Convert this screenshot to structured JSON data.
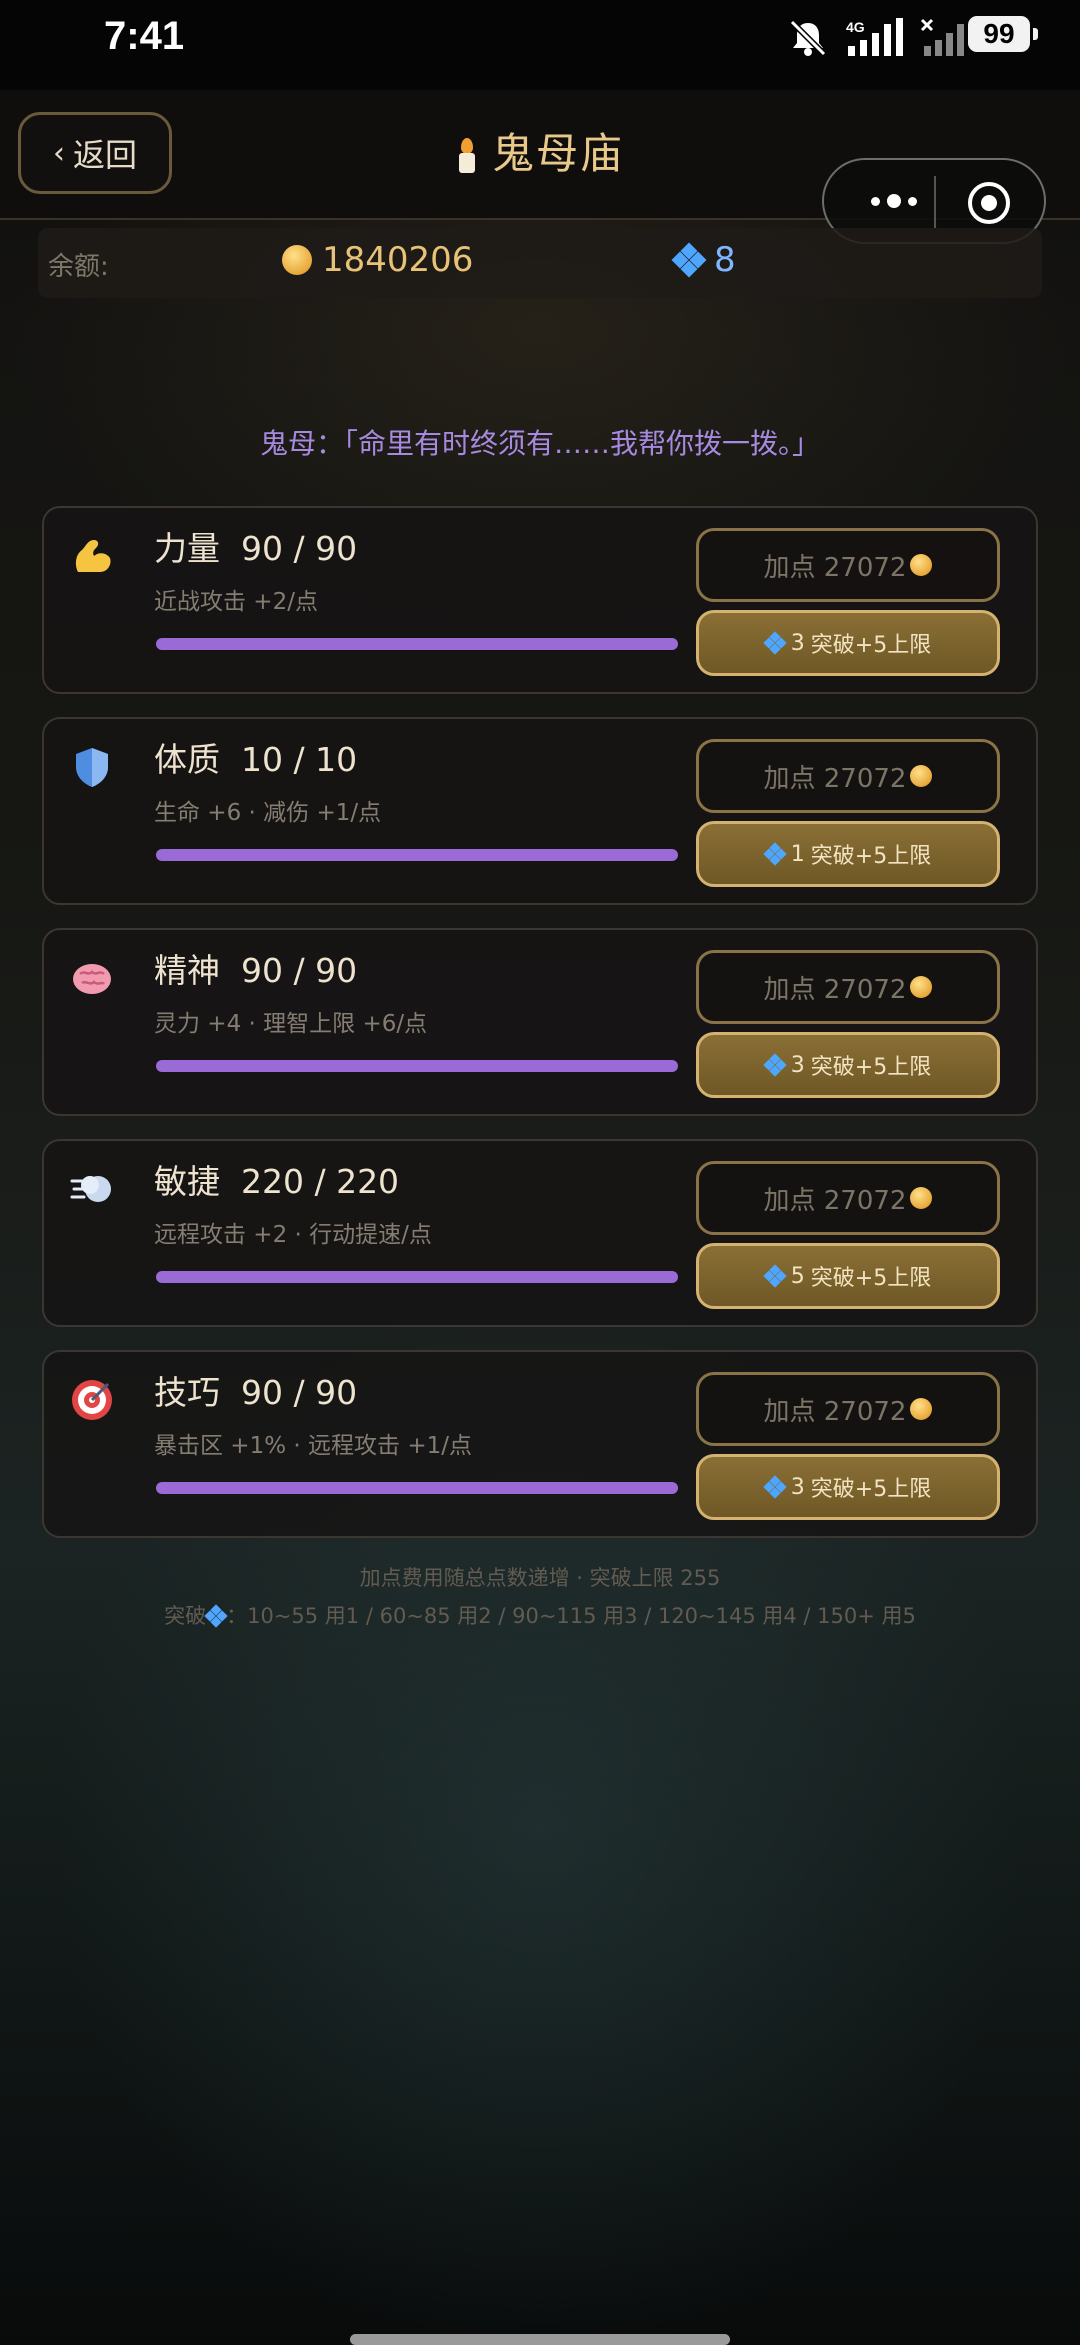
{
  "status_bar": {
    "time": "7:41",
    "network": "4G",
    "battery": "99"
  },
  "nav": {
    "back_label": "返回",
    "title": "鬼母庙"
  },
  "balance": {
    "label": "余额:",
    "gold": "1840206",
    "gems": "8"
  },
  "dialogue": "鬼母：「命里有时终须有……我帮你拨一拨。」",
  "stats": [
    {
      "icon": "muscle-icon",
      "name": "力量",
      "value": "90 / 90",
      "desc": "近战攻击 +2/点",
      "progress": 1.0,
      "add_label": "加点 27072",
      "break_cost": "3",
      "break_label": "突破+5上限"
    },
    {
      "icon": "shield-icon",
      "name": "体质",
      "value": "10 / 10",
      "desc": "生命 +6 · 减伤 +1/点",
      "progress": 1.0,
      "add_label": "加点 27072",
      "break_cost": "1",
      "break_label": "突破+5上限"
    },
    {
      "icon": "brain-icon",
      "name": "精神",
      "value": "90 / 90",
      "desc": "灵力 +4 · 理智上限 +6/点",
      "progress": 1.0,
      "add_label": "加点 27072",
      "break_cost": "3",
      "break_label": "突破+5上限"
    },
    {
      "icon": "wind-icon",
      "name": "敏捷",
      "value": "220 / 220",
      "desc": "远程攻击 +2 · 行动提速/点",
      "progress": 1.0,
      "add_label": "加点 27072",
      "break_cost": "5",
      "break_label": "突破+5上限"
    },
    {
      "icon": "target-icon",
      "name": "技巧",
      "value": "90 / 90",
      "desc": "暴击区 +1% · 远程攻击 +1/点",
      "progress": 1.0,
      "add_label": "加点 27072",
      "break_cost": "3",
      "break_label": "突破+5上限"
    }
  ],
  "footer": {
    "line1": "加点费用随总点数递增 · 突破上限 255",
    "line2_prefix": "突破",
    "line2_rest": "：10~55 用1 / 60~85 用2 / 90~115 用3 / 120~145 用4 / 150+ 用5"
  },
  "colors": {
    "accent_gold": "#d4b271",
    "progress": "#9a6bd6",
    "dialogue": "#a789e0",
    "gem": "#4fa6ff"
  }
}
